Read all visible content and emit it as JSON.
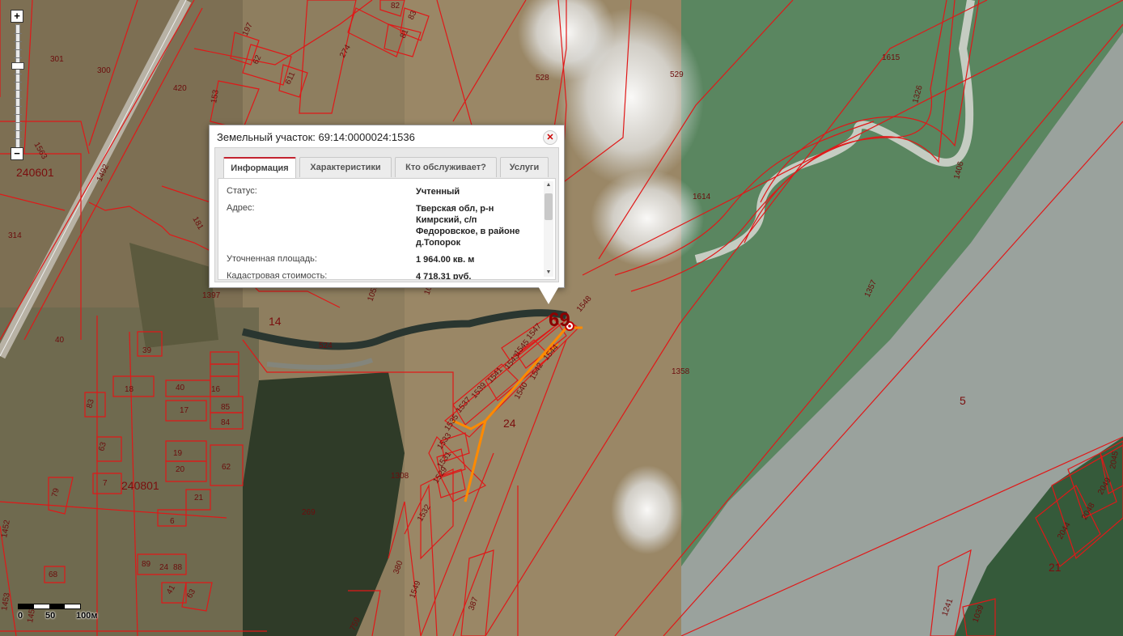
{
  "popup": {
    "title": "Земельный участок: 69:14:0000024:1536",
    "close_icon": "close-icon",
    "tabs": [
      "Информация",
      "Характеристики",
      "Кто обслуживает?",
      "Услуги"
    ],
    "active_tab": "Информация",
    "fields": [
      {
        "label": "Статус:",
        "value": "Учтенный"
      },
      {
        "label": "Адрес:",
        "value_lines": [
          "Тверская обл, р-н",
          "Кимрский, с/п",
          "Федоровское, в районе",
          "д.Топорок"
        ]
      },
      {
        "label": "Уточненная площадь:",
        "value": "1 964.00 кв. м"
      },
      {
        "label": "Кадастровая стоимость:",
        "value": "4 718.31 руб."
      }
    ]
  },
  "zoom": {
    "plus": "+",
    "minus": "−"
  },
  "scale": {
    "labels": [
      "0",
      "50",
      "100м"
    ]
  },
  "map": {
    "marker": "69",
    "quarters": [
      "240601",
      "240801"
    ],
    "large_labels": [
      "14",
      "24",
      "5",
      "21"
    ],
    "parcels": [
      "301",
      "300",
      "420",
      "314",
      "1563",
      "1492",
      "181",
      "40",
      "153",
      "197",
      "62",
      "611",
      "274",
      "82",
      "83",
      "81",
      "528",
      "529",
      "1615",
      "1326",
      "1614",
      "1406",
      "1357",
      "1358",
      "1397",
      "1059",
      "1058",
      "524",
      "1548",
      "1547",
      "1545",
      "1543",
      "1544",
      "1541",
      "1542",
      "1539",
      "1540",
      "1537",
      "1535",
      "1533",
      "1531",
      "1529",
      "1532",
      "1308",
      "269",
      "380",
      "1549",
      "387",
      "759",
      "39",
      "18",
      "40",
      "16",
      "85",
      "84",
      "17",
      "83",
      "63",
      "19",
      "20",
      "62",
      "79",
      "7",
      "21",
      "6",
      "89",
      "24",
      "88",
      "41",
      "63",
      "68",
      "1452",
      "1453",
      "1451",
      "2045",
      "2049",
      "2048",
      "2044",
      "1241",
      "1039"
    ]
  },
  "colors": {
    "boundary": "#e01818",
    "highlight": "#ff8a00",
    "water": "#5f8a62",
    "field": "#8e7e5f"
  }
}
